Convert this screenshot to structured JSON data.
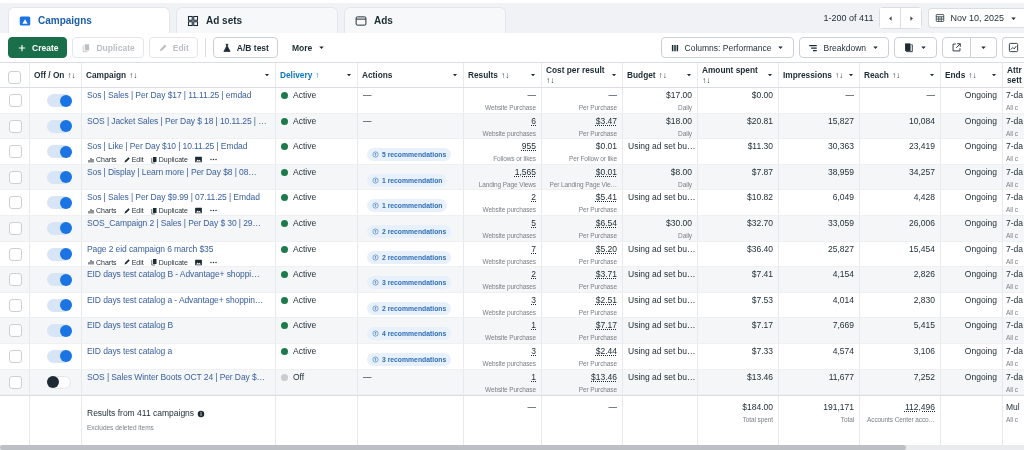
{
  "tabs": [
    {
      "label": "Campaigns",
      "kind": "campaigns",
      "selected": true
    },
    {
      "label": "Ad sets",
      "kind": "adsets",
      "selected": false
    },
    {
      "label": "Ads",
      "kind": "ads",
      "selected": false
    }
  ],
  "pager": {
    "range": "1-200 of 411"
  },
  "date_range": "Nov 10, 2025",
  "toolbar": {
    "left": [
      {
        "label": "Create",
        "kind": "create",
        "disabled": false
      },
      {
        "label": "Duplicate",
        "kind": "duplicate",
        "disabled": true
      },
      {
        "label": "Edit",
        "kind": "edit",
        "disabled": true
      },
      {
        "label": "A/B test",
        "kind": "abtest",
        "disabled": false
      },
      {
        "label": "More",
        "kind": "more",
        "disabled": false
      }
    ],
    "right": [
      {
        "label": "Columns: Performance",
        "kind": "columns"
      },
      {
        "label": "Breakdown",
        "kind": "breakdown"
      },
      {
        "kind": "reports"
      },
      {
        "kind": "export"
      },
      {
        "kind": "chart"
      }
    ]
  },
  "table": {
    "all_selected": false,
    "columns": [
      {
        "kind": "toggle",
        "label": "Off / On",
        "sort": "↑↓",
        "sorted": false
      },
      {
        "kind": "name",
        "label": "Campaign",
        "sort": "↑↓",
        "sorted": false
      },
      {
        "kind": "delivery",
        "label": "Delivery",
        "sort": "↑",
        "sorted": true
      },
      {
        "kind": "actions",
        "label": "Actions",
        "sorted": false
      },
      {
        "kind": "results",
        "label": "Results",
        "sort": "↑↓",
        "sorted": false
      },
      {
        "kind": "cost",
        "label": "Cost per result",
        "sort": "↑↓",
        "sorted": false
      },
      {
        "kind": "budget",
        "label": "Budget",
        "sort": "↑↓",
        "sorted": false
      },
      {
        "kind": "amount",
        "label": "Amount spent",
        "sort": "↑↓",
        "sorted": false
      },
      {
        "kind": "impressions",
        "label": "Impressions",
        "sort": "↑↓",
        "sorted": false
      },
      {
        "kind": "reach",
        "label": "Reach",
        "sort": "↑↓",
        "sorted": false
      },
      {
        "kind": "ends",
        "label": "Ends",
        "sort": "↑↓",
        "sorted": false
      },
      {
        "kind": "attr",
        "label": "Attr sett",
        "sorted": false
      }
    ],
    "rows": [
      {
        "selected": false,
        "on": true,
        "name": "Sos | Sales | Per Day $17 | 11.11.25 | emdad",
        "delivery": {
          "label": "Active",
          "color": "#1d7a4c"
        },
        "actions": {
          "kind": "none",
          "text": "—"
        },
        "results": {
          "value": "—",
          "label": "Website Purchase",
          "linked": false
        },
        "cost": {
          "value": "—",
          "label": "Per Purchase",
          "linked": false
        },
        "budget": {
          "value": "$17.00",
          "label": "Daily"
        },
        "amount": "$0.00",
        "impressions": "—",
        "reach": "—",
        "ends": "Ongoing",
        "attr": {
          "value": "7-da",
          "label": "All c"
        }
      },
      {
        "selected": false,
        "on": true,
        "name": "SOS | Jacket Sales | Per Day $ 18 | 10.11.25 | …",
        "delivery": {
          "label": "Active",
          "color": "#1d7a4c"
        },
        "actions": {
          "kind": "none",
          "text": "—"
        },
        "results": {
          "value": "6",
          "label": "Website purchases",
          "linked": true
        },
        "cost": {
          "value": "$3.47",
          "label": "Per Purchase",
          "linked": true
        },
        "budget": {
          "value": "$18.00",
          "label": "Daily"
        },
        "amount": "$20.81",
        "impressions": "15,827",
        "reach": "10,084",
        "ends": "Ongoing",
        "attr": {
          "value": "7-da",
          "label": "All c"
        }
      },
      {
        "selected": false,
        "on": true,
        "name": "Sos | Like | Per Day $10 | 10.11.25 | Emdad",
        "quick_actions": [
          {
            "label": "Charts",
            "kind": "charts"
          },
          {
            "label": "Edit",
            "kind": "edit"
          },
          {
            "label": "Duplicate",
            "kind": "duplicate"
          },
          {
            "kind": "image"
          },
          {
            "kind": "more"
          }
        ],
        "delivery": {
          "label": "Active",
          "color": "#1d7a4c"
        },
        "actions": {
          "kind": "recommendation",
          "text": "5 recommendations"
        },
        "results": {
          "value": "955",
          "label": "Follows or likes",
          "linked": true
        },
        "cost": {
          "value": "$0.01",
          "label": "Per Follow or like",
          "linked": false
        },
        "budget": {
          "value": "Using ad set bu…"
        },
        "amount": "$11.30",
        "impressions": "30,363",
        "reach": "23,419",
        "ends": "Ongoing",
        "attr": {
          "value": "7-da",
          "label": "All c"
        }
      },
      {
        "selected": false,
        "on": true,
        "name": "Sos | Display | Learn more | Per Day $8 | 08…",
        "delivery": {
          "label": "Active",
          "color": "#1d7a4c"
        },
        "actions": {
          "kind": "recommendation",
          "text": "1 recommendation"
        },
        "results": {
          "value": "1,565",
          "label": "Landing Page Views",
          "linked": true
        },
        "cost": {
          "value": "$0.01",
          "label": "Per Landing Page Vie…",
          "linked": true
        },
        "budget": {
          "value": "$8.00",
          "label": "Daily"
        },
        "amount": "$7.87",
        "impressions": "38,959",
        "reach": "34,257",
        "ends": "Ongoing",
        "attr": {
          "value": "7-da",
          "label": "All c"
        }
      },
      {
        "selected": false,
        "on": true,
        "name": "Sos | Sales | Per Day $9.99 | 07.11.25 | Emdad",
        "quick_actions": [
          {
            "label": "Charts",
            "kind": "charts"
          },
          {
            "label": "Edit",
            "kind": "edit"
          },
          {
            "label": "Duplicate",
            "kind": "duplicate"
          },
          {
            "kind": "image"
          },
          {
            "kind": "more"
          }
        ],
        "delivery": {
          "label": "Active",
          "color": "#1d7a4c"
        },
        "actions": {
          "kind": "recommendation",
          "text": "1 recommendation"
        },
        "results": {
          "value": "2",
          "label": "Website purchases",
          "linked": true
        },
        "cost": {
          "value": "$5.41",
          "label": "Per Purchase",
          "linked": true
        },
        "budget": {
          "value": "Using ad set bu…"
        },
        "amount": "$10.82",
        "impressions": "6,049",
        "reach": "4,428",
        "ends": "Ongoing",
        "attr": {
          "value": "7-da",
          "label": "All c"
        }
      },
      {
        "selected": false,
        "on": true,
        "name": "SOS_Campaign 2 | Sales | Per Day $ 30 | 29…",
        "delivery": {
          "label": "Active",
          "color": "#1d7a4c"
        },
        "actions": {
          "kind": "recommendation",
          "text": "2 recommendations"
        },
        "results": {
          "value": "5",
          "label": "Website purchases",
          "linked": true
        },
        "cost": {
          "value": "$6.54",
          "label": "Per Purchase",
          "linked": true
        },
        "budget": {
          "value": "$30.00",
          "label": "Daily"
        },
        "amount": "$32.70",
        "impressions": "33,059",
        "reach": "26,006",
        "ends": "Ongoing",
        "attr": {
          "value": "7-da",
          "label": "All c"
        }
      },
      {
        "selected": false,
        "on": true,
        "name": "Page 2 eid campaign 6 march $35",
        "quick_actions": [
          {
            "label": "Charts",
            "kind": "charts"
          },
          {
            "label": "Edit",
            "kind": "edit"
          },
          {
            "label": "Duplicate",
            "kind": "duplicate"
          },
          {
            "kind": "image"
          },
          {
            "kind": "more"
          }
        ],
        "delivery": {
          "label": "Active",
          "color": "#1d7a4c"
        },
        "actions": {
          "kind": "recommendation",
          "text": "2 recommendations"
        },
        "results": {
          "value": "7",
          "label": "Website purchases",
          "linked": true
        },
        "cost": {
          "value": "$5.20",
          "label": "Per Purchase",
          "linked": true
        },
        "budget": {
          "value": "Using ad set bu…"
        },
        "amount": "$36.40",
        "impressions": "25,827",
        "reach": "15,454",
        "ends": "Ongoing",
        "attr": {
          "value": "7-da",
          "label": "All c"
        }
      },
      {
        "selected": false,
        "on": true,
        "name": "EID days test catalog B - Advantage+ shoppi…",
        "delivery": {
          "label": "Active",
          "color": "#1d7a4c"
        },
        "actions": {
          "kind": "recommendation",
          "text": "3 recommendations"
        },
        "results": {
          "value": "2",
          "label": "Website purchases",
          "linked": true
        },
        "cost": {
          "value": "$3.71",
          "label": "Per Purchase",
          "linked": true
        },
        "budget": {
          "value": "Using ad set bu…"
        },
        "amount": "$7.41",
        "impressions": "4,154",
        "reach": "2,826",
        "ends": "Ongoing",
        "attr": {
          "value": "7-da",
          "label": "All c"
        }
      },
      {
        "selected": false,
        "on": true,
        "name": "EID days test catalog a - Advantage+ shoppin…",
        "delivery": {
          "label": "Active",
          "color": "#1d7a4c"
        },
        "actions": {
          "kind": "recommendation",
          "text": "2 recommendations"
        },
        "results": {
          "value": "3",
          "label": "Website purchases",
          "linked": true
        },
        "cost": {
          "value": "$2.51",
          "label": "Per Purchase",
          "linked": true
        },
        "budget": {
          "value": "Using ad set bu…"
        },
        "amount": "$7.53",
        "impressions": "4,014",
        "reach": "2,830",
        "ends": "Ongoing",
        "attr": {
          "value": "7-da",
          "label": "All c"
        }
      },
      {
        "selected": false,
        "on": true,
        "name": "EID days test catalog B",
        "delivery": {
          "label": "Active",
          "color": "#1d7a4c"
        },
        "actions": {
          "kind": "recommendation",
          "text": "4 recommendations"
        },
        "results": {
          "value": "1",
          "label": "Website Purchase",
          "linked": true
        },
        "cost": {
          "value": "$7.17",
          "label": "Per Purchase",
          "linked": true
        },
        "budget": {
          "value": "Using ad set bu…"
        },
        "amount": "$7.17",
        "impressions": "7,669",
        "reach": "5,415",
        "ends": "Ongoing",
        "attr": {
          "value": "7-da",
          "label": "All c"
        }
      },
      {
        "selected": false,
        "on": true,
        "name": "EID days test catalog a",
        "delivery": {
          "label": "Active",
          "color": "#1d7a4c"
        },
        "actions": {
          "kind": "recommendation",
          "text": "3 recommendations"
        },
        "results": {
          "value": "3",
          "label": "Website purchases",
          "linked": true
        },
        "cost": {
          "value": "$2.44",
          "label": "Per Purchase",
          "linked": true
        },
        "budget": {
          "value": "Using ad set bu…"
        },
        "amount": "$7.33",
        "impressions": "4,574",
        "reach": "3,106",
        "ends": "Ongoing",
        "attr": {
          "value": "7-da",
          "label": "All c"
        }
      },
      {
        "selected": false,
        "on": false,
        "name": "SOS | Sales Winter Boots OCT 24 | Per Day $…",
        "delivery": {
          "label": "Off",
          "color": "#c9ccd1"
        },
        "actions": {
          "kind": "none",
          "text": "—"
        },
        "results": {
          "value": "1",
          "label": "Website Purchase",
          "linked": true
        },
        "cost": {
          "value": "$13.46",
          "label": "Per Purchase",
          "linked": true
        },
        "budget": {
          "value": "Using ad set bu…"
        },
        "amount": "$13.46",
        "impressions": "11,677",
        "reach": "7,252",
        "ends": "Ongoing",
        "attr": {
          "value": "7-da",
          "label": "All c"
        }
      }
    ],
    "totals": {
      "title": "Results from 411 campaigns",
      "note": "Excludes deleted items",
      "results": {
        "value": "—"
      },
      "cost": {
        "value": "—"
      },
      "amount": {
        "value": "$184.00",
        "label": "Total spent"
      },
      "impressions": {
        "value": "191,171",
        "label": "Total"
      },
      "reach": {
        "value": "112,496",
        "label": "Accounts Center acco…",
        "linked": true
      },
      "attr": {
        "value": "Mul",
        "label": "All c"
      }
    }
  }
}
